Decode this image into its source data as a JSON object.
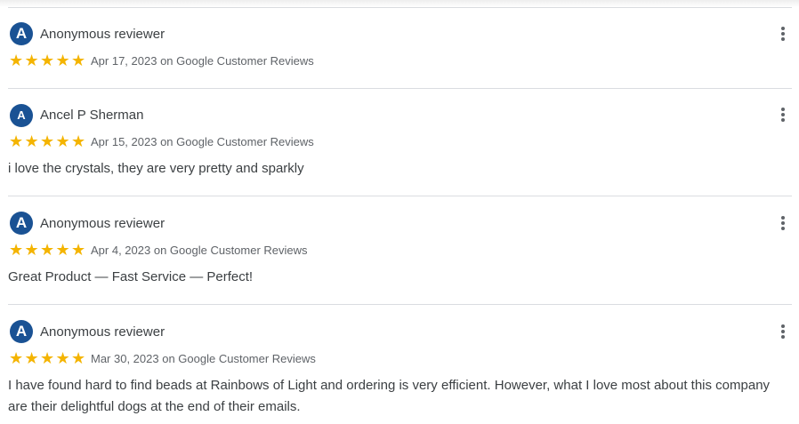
{
  "reviews": [
    {
      "avatar_letter": "A",
      "name": "Anonymous reviewer",
      "rating": 5,
      "stars": "★★★★★",
      "date": "Apr 17, 2023",
      "source": "on Google Customer Reviews",
      "text": ""
    },
    {
      "avatar_letter": "A",
      "name": "Ancel P Sherman",
      "rating": 5,
      "stars": "★★★★★",
      "date": "Apr 15, 2023",
      "source": "on Google Customer Reviews",
      "text": "i love the crystals, they are very pretty and sparkly"
    },
    {
      "avatar_letter": "A",
      "name": "Anonymous reviewer",
      "rating": 5,
      "stars": "★★★★★",
      "date": "Apr 4, 2023",
      "source": "on Google Customer Reviews",
      "text": "Great Product — Fast Service — Perfect!"
    },
    {
      "avatar_letter": "A",
      "name": "Anonymous reviewer",
      "rating": 5,
      "stars": "★★★★★",
      "date": "Mar 30, 2023",
      "source": "on Google Customer Reviews",
      "text": "I have found hard to find beads at Rainbows of Light and ordering is very efficient. However, what I love most about this company are their delightful dogs at the end of their emails."
    }
  ],
  "colors": {
    "avatar": "#1a5294",
    "star": "#f4b400",
    "divider": "#dadce0",
    "meta_text": "#5f6368"
  },
  "icons": {
    "star": "star-icon",
    "more": "more-vert-icon"
  }
}
